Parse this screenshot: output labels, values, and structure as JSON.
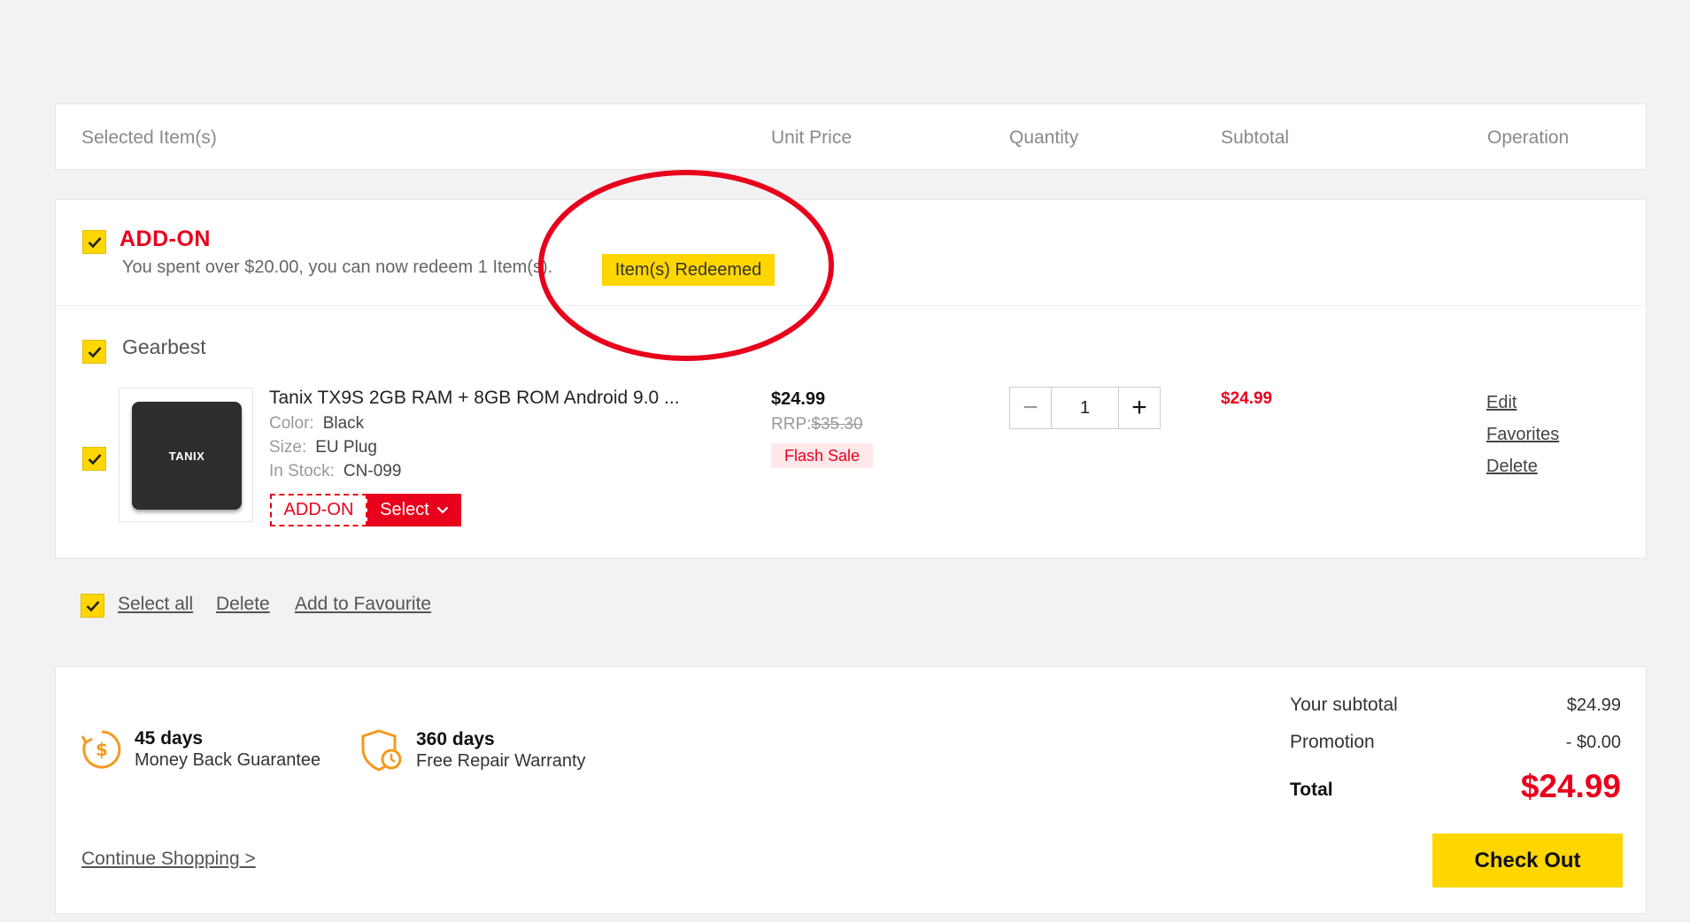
{
  "table_header": {
    "selected_items": "Selected Item(s)",
    "unit_price": "Unit Price",
    "quantity": "Quantity",
    "subtotal": "Subtotal",
    "operation": "Operation"
  },
  "addon": {
    "title": "ADD-ON",
    "description": "You spent over $20.00, you can now redeem 1 Item(s).",
    "arrow": ">",
    "redeemed_badge": "Item(s) Redeemed",
    "checked": true
  },
  "store": {
    "name": "Gearbest",
    "checked": true
  },
  "item": {
    "checked": true,
    "thumbnail_brand": "TANIX",
    "title": "Tanix TX9S 2GB RAM + 8GB ROM Android 9.0 ...",
    "attributes": [
      {
        "key": "Color:",
        "value": "Black"
      },
      {
        "key": "Size:",
        "value": "EU Plug"
      },
      {
        "key": "In Stock:",
        "value": "CN-099"
      }
    ],
    "addon_tag": "ADD-ON",
    "select_label": "Select",
    "price": "$24.99",
    "rrp_label": "RRP:",
    "rrp_value": "$35.30",
    "flash_sale": "Flash Sale",
    "quantity": "1",
    "qty_minus": "−",
    "qty_plus": "+",
    "subtotal": "$24.99",
    "operations": {
      "edit": "Edit",
      "favorites": "Favorites",
      "delete": "Delete"
    }
  },
  "actions": {
    "select_all": "Select all",
    "delete": "Delete",
    "add_to_favourite": "Add to Favourite"
  },
  "guarantees": [
    {
      "icon": "money-back-icon",
      "title": "45 days",
      "subtitle": "Money Back Guarantee"
    },
    {
      "icon": "shield-clock-icon",
      "title": "360 days",
      "subtitle": "Free Repair Warranty"
    }
  ],
  "summary": {
    "subtotal_label": "Your subtotal",
    "subtotal_value": "$24.99",
    "promotion_label": "Promotion",
    "promotion_value": "- $0.00",
    "total_label": "Total",
    "total_value": "$24.99"
  },
  "continue_shopping": "Continue Shopping >",
  "checkout_label": "Check Out",
  "colors": {
    "accent_yellow": "#ffd600",
    "accent_red": "#e8001c",
    "guarantee_orange": "#f39a1f",
    "annotation_red": "#e8001c"
  }
}
